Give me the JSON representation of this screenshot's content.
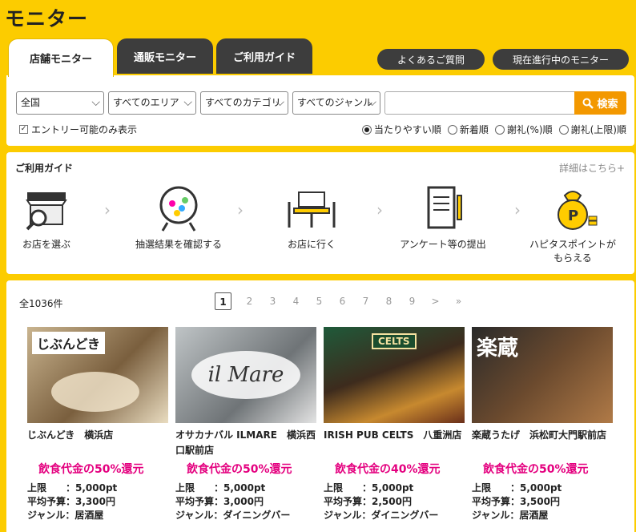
{
  "page": {
    "title": "モニター"
  },
  "tabs": [
    "店舗モニター",
    "通販モニター",
    "ご利用ガイド"
  ],
  "links": {
    "faq": "よくあるご質問",
    "ongoing": "現在進行中のモニター"
  },
  "search": {
    "selects": [
      "全国",
      "すべてのエリア",
      "すべてのカテゴリ",
      "すべてのジャンル"
    ],
    "keyword_value": "",
    "button": "検索",
    "checkbox_label": "エントリー可能のみ表示",
    "sort_options": [
      "当たりやすい順",
      "新着順",
      "謝礼(%)順",
      "謝礼(上限)順"
    ]
  },
  "guide": {
    "title": "ご利用ガイド",
    "more": "詳細はこちら+",
    "steps": [
      "お店を選ぶ",
      "抽選結果を確認する",
      "お店に行く",
      "アンケート等の提出",
      "ハピタスポイントが\nもらえる"
    ]
  },
  "list": {
    "count": "全1036件",
    "pages": [
      "1",
      "2",
      "3",
      "4",
      "5",
      "6",
      "7",
      "8",
      "9",
      ">",
      "»"
    ],
    "cards": [
      {
        "name": "じぶんどき　横浜店",
        "reward": "飲食代金の50%還元",
        "limit": "上限　　：5,000pt",
        "budget": "平均予算：3,300円",
        "genre": "ジャンル：居酒屋",
        "logo": "じぶんどき"
      },
      {
        "name": "オサカナバル ILMARE　横浜西口駅前店",
        "reward": "飲食代金の50%還元",
        "limit": "上限　　：5,000pt",
        "budget": "平均予算：3,000円",
        "genre": "ジャンル：ダイニングバー",
        "logo": "il Mare"
      },
      {
        "name": "IRISH PUB CELTS　八重洲店",
        "reward": "飲食代金の40%還元",
        "limit": "上限　　：5,000pt",
        "budget": "平均予算：2,500円",
        "genre": "ジャンル：ダイニングバー",
        "logo": "CELTS"
      },
      {
        "name": "楽蔵うたげ　浜松町大門駅前店",
        "reward": "飲食代金の50%還元",
        "limit": "上限　　：5,000pt",
        "budget": "平均予算：3,500円",
        "genre": "ジャンル：居酒屋",
        "logo": "楽蔵"
      }
    ]
  },
  "colors": {
    "accent": "#fccc00",
    "search": "#f39800",
    "reward": "#e4007f",
    "dark": "#3d3d3d"
  }
}
